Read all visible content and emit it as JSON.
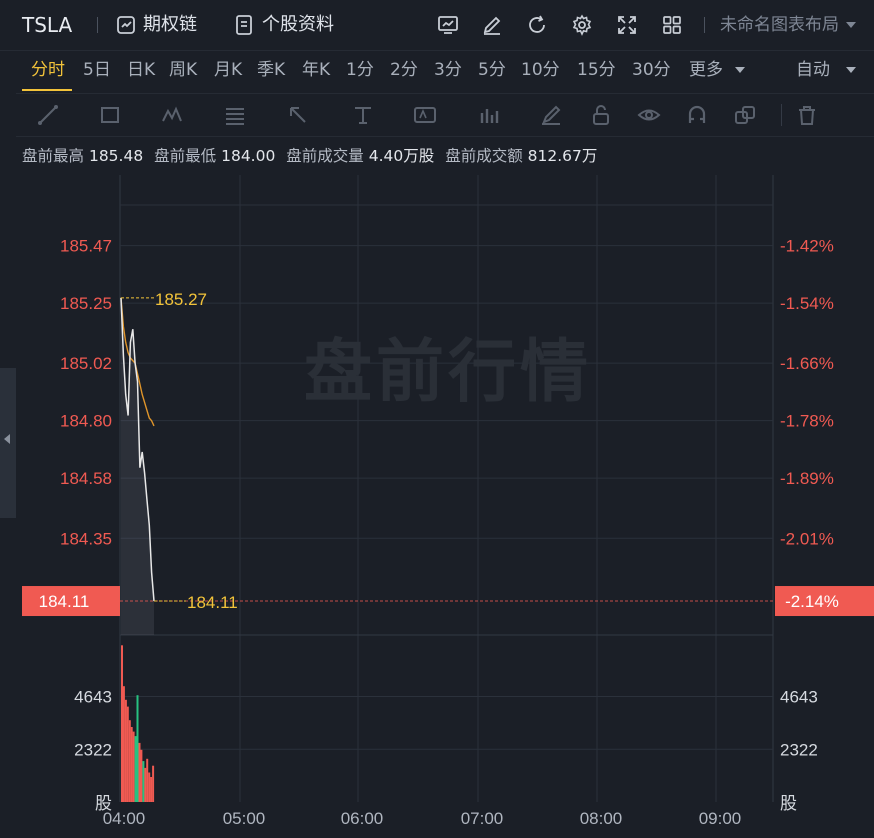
{
  "header": {
    "ticker": "TSLA",
    "options_chain": "期权链",
    "stock_profile": "个股资料",
    "layout_name": "未命名图表布局",
    "icons": [
      "chart-monitor-icon",
      "edit-icon",
      "refresh-icon",
      "settings-icon",
      "fullscreen-icon",
      "grid-layout-icon"
    ]
  },
  "periods": {
    "items": [
      "分时",
      "5日",
      "日K",
      "周K",
      "月K",
      "季K",
      "年K",
      "1分",
      "2分",
      "3分",
      "5分",
      "10分",
      "15分",
      "30分"
    ],
    "active": "分时",
    "more": "更多",
    "auto": "自动"
  },
  "stats": {
    "high_label": "盘前最高",
    "high": "185.48",
    "low_label": "盘前最低",
    "low": "184.00",
    "volume_label": "盘前成交量",
    "volume": "4.40万股",
    "turnover_label": "盘前成交额",
    "turnover": "812.67万"
  },
  "watermark": "盘前行情",
  "colors": {
    "accent": "#f2c33a",
    "down": "#f05a52",
    "up": "#27c280",
    "price_line": "#e8e8e8",
    "avg_line": "#e0952a"
  },
  "chart_data": {
    "type": "line",
    "price_ticks": [
      "185.47",
      "185.25",
      "185.02",
      "184.80",
      "184.58",
      "184.35"
    ],
    "pct_ticks": [
      "-1.42%",
      "-1.54%",
      "-1.66%",
      "-1.78%",
      "-1.89%",
      "-2.01%"
    ],
    "current_price": "184.11",
    "current_pct": "-2.14%",
    "open_marker": "185.27",
    "last_marker": "184.11",
    "time_ticks": [
      "04:00",
      "05:00",
      "06:00",
      "07:00",
      "08:00",
      "09:00"
    ],
    "volume_ticks": [
      "4643",
      "2322"
    ],
    "volume_unit": "股",
    "price_range": [
      183.98,
      185.74
    ],
    "volume_max": 7000,
    "price_series": [
      185.27,
      185.05,
      184.9,
      184.82,
      185.1,
      185.15,
      185.02,
      184.95,
      184.62,
      184.68,
      184.6,
      184.5,
      184.4,
      184.22,
      184.11
    ],
    "avg_series": [
      185.27,
      185.16,
      185.1,
      185.06,
      185.04,
      185.03,
      185.02,
      184.98,
      184.94,
      184.9,
      184.87,
      184.84,
      184.81,
      184.8,
      184.78
    ],
    "volumes": [
      6900,
      5100,
      4500,
      4200,
      3600,
      3300,
      3100,
      2900,
      4700,
      2600,
      2300,
      1800,
      1500,
      1900,
      1300,
      1100,
      1600
    ],
    "volume_dir": [
      "down",
      "down",
      "down",
      "down",
      "down",
      "down",
      "down",
      "up",
      "up",
      "down",
      "down",
      "up",
      "down",
      "down",
      "down",
      "down",
      "down"
    ]
  }
}
